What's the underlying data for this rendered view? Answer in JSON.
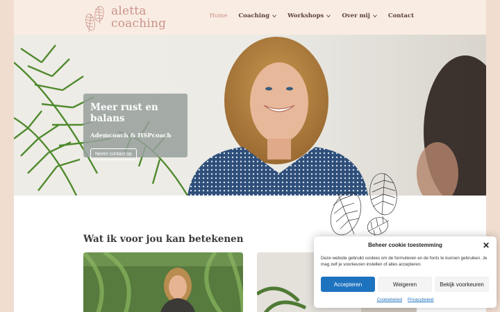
{
  "logo": {
    "line1": "aletta",
    "line2": "coaching"
  },
  "nav": [
    {
      "label": "Home",
      "active": true,
      "dropdown": false
    },
    {
      "label": "Coaching",
      "active": false,
      "dropdown": true
    },
    {
      "label": "Workshops",
      "active": false,
      "dropdown": true
    },
    {
      "label": "Over mij",
      "active": false,
      "dropdown": true
    },
    {
      "label": "Contact",
      "active": false,
      "dropdown": false
    }
  ],
  "hero": {
    "title": "Meer rust en balans",
    "subtitle": "Ademcoach & HSPcoach",
    "button": "Neem contact op"
  },
  "section": {
    "title": "Wat ik voor jou kan betekenen"
  },
  "cookie": {
    "title": "Beheer cookie toestemming",
    "text": "Deze website gebruikt cookies om de formulieren en de fonts te kunnen gebruiken. Je mag zelf je voorkeuren instellen of alles accepteren.",
    "accept": "Accepteren",
    "deny": "Weigeren",
    "preferences": "Bekijk voorkeuren",
    "link1": "Cookiebeleid",
    "link2": "Privacybeleid"
  },
  "colors": {
    "accent": "#c9938a",
    "header_bg": "#f9ece3",
    "page_bg": "#f0ddd0",
    "button_blue": "#1e73be"
  }
}
